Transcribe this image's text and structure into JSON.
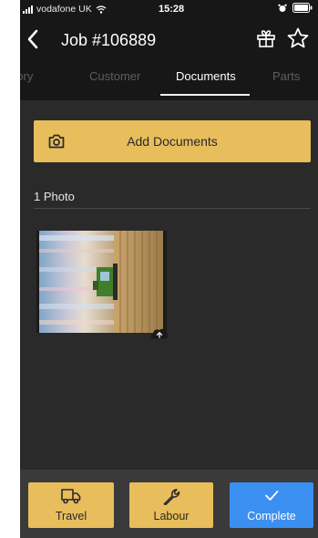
{
  "status_bar": {
    "carrier": "vodafone UK",
    "time": "15:28"
  },
  "nav": {
    "title": "Job #106889",
    "back_icon": "chevron-left-icon",
    "gift_icon": "gift-icon",
    "star_icon": "star-outline-icon"
  },
  "tabs": [
    {
      "label": "Story",
      "active": false
    },
    {
      "label": "Customer",
      "active": false
    },
    {
      "label": "Documents",
      "active": true
    },
    {
      "label": "Parts",
      "active": false
    }
  ],
  "documents": {
    "add_button_label": "Add Documents",
    "section_heading": "1 Photo",
    "photos": [
      {
        "description": "combine-harvester-field-photo",
        "upload_status_icon": "cloud-upload-icon"
      }
    ]
  },
  "actions": {
    "travel_label": "Travel",
    "labour_label": "Labour",
    "complete_label": "Complete"
  },
  "colors": {
    "accent_yellow": "#e8bd5c",
    "complete_blue": "#3b8ff0",
    "background": "#2a2a2a",
    "header_background": "#171717",
    "inactive_tab": "#5e5e5e"
  }
}
